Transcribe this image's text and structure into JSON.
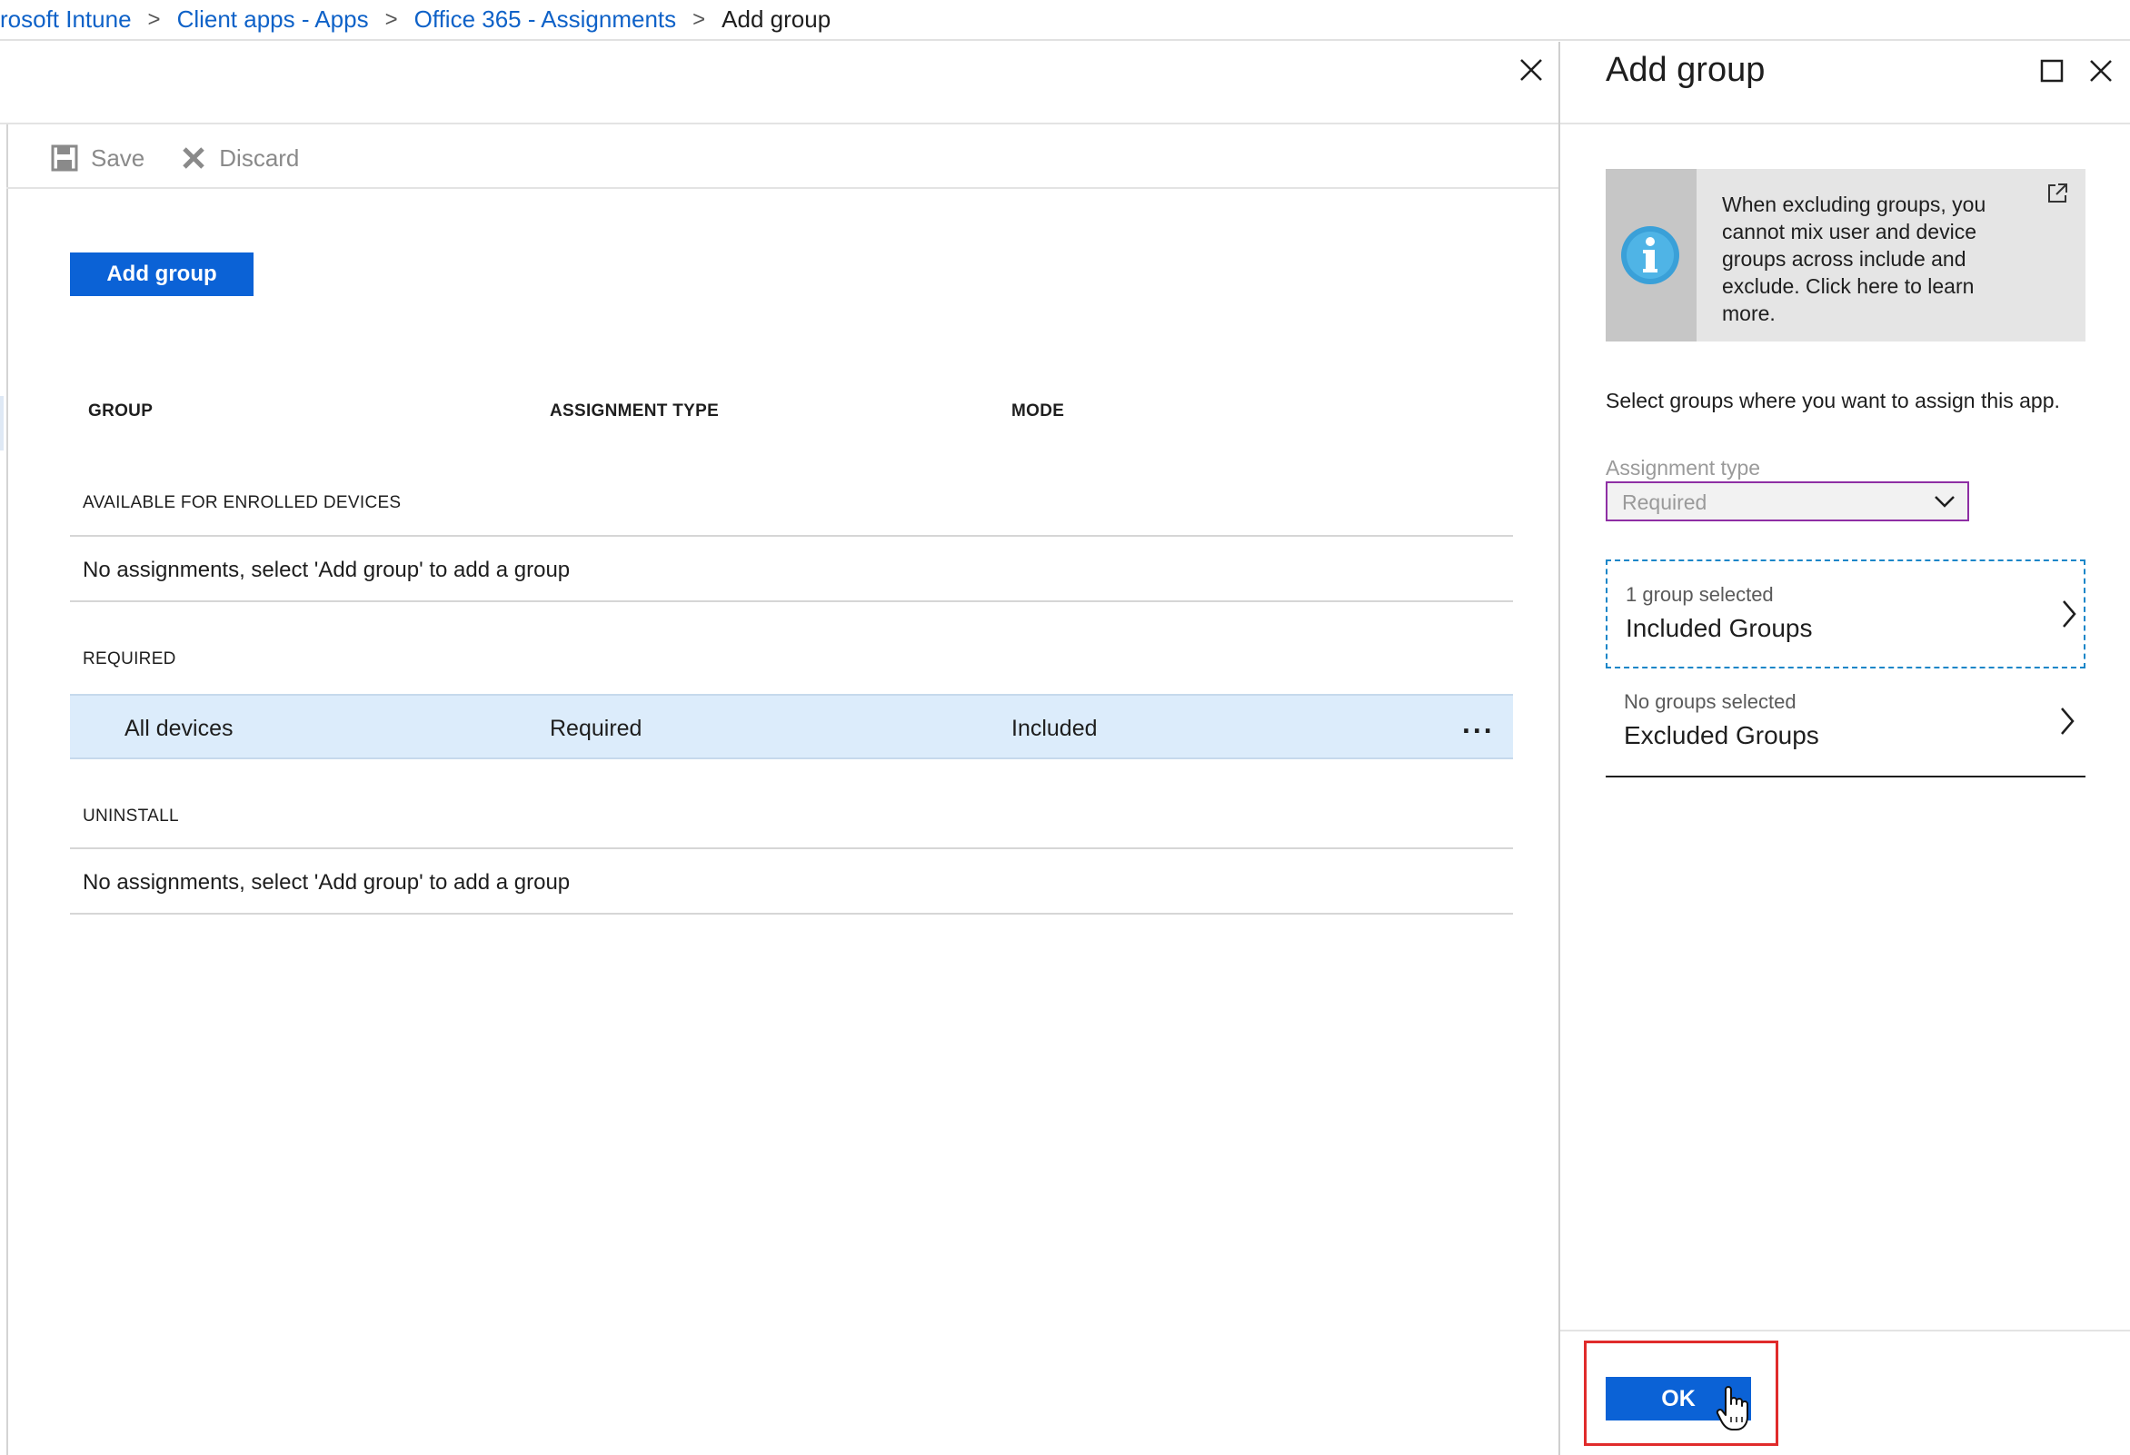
{
  "breadcrumb": {
    "items": [
      "rosoft Intune",
      "Client apps - Apps",
      "Office 365 - Assignments"
    ],
    "current": "Add group",
    "separator": ">"
  },
  "toolbar": {
    "save_label": "Save",
    "discard_label": "Discard"
  },
  "main": {
    "add_group_label": "Add group",
    "columns": [
      "GROUP",
      "ASSIGNMENT TYPE",
      "MODE"
    ],
    "sections": {
      "available": {
        "label": "AVAILABLE FOR ENROLLED DEVICES",
        "empty_message": "No assignments, select 'Add group' to add a group"
      },
      "required": {
        "label": "REQUIRED",
        "row": {
          "group": "All devices",
          "assignment_type": "Required",
          "mode": "Included",
          "more": "..."
        }
      },
      "uninstall": {
        "label": "UNINSTALL",
        "empty_message": "No assignments, select 'Add group' to add a group"
      }
    }
  },
  "panel": {
    "title": "Add group",
    "info_text": "When excluding groups, you cannot mix user and device groups across include and exclude.  Click here to learn more.",
    "select_description": "Select groups where you want to assign this app.",
    "assignment_type_label": "Assignment type",
    "assignment_type_value": "Required",
    "included": {
      "subtitle": "1 group selected",
      "title": "Included Groups"
    },
    "excluded": {
      "subtitle": "No groups selected",
      "title": "Excluded Groups"
    },
    "ok_label": "OK"
  },
  "colors": {
    "accent": "#0b62d6",
    "link": "#0f62c8",
    "selected_row": "#dcecfb",
    "focus_outline": "#8e2fa4",
    "highlight_box": "#e02b2b"
  },
  "icons": [
    "save-icon",
    "discard-icon",
    "close-icon",
    "maximize-icon",
    "info-icon",
    "external-link-icon",
    "chevron-down-icon",
    "chevron-right-icon",
    "hand-cursor-icon"
  ]
}
